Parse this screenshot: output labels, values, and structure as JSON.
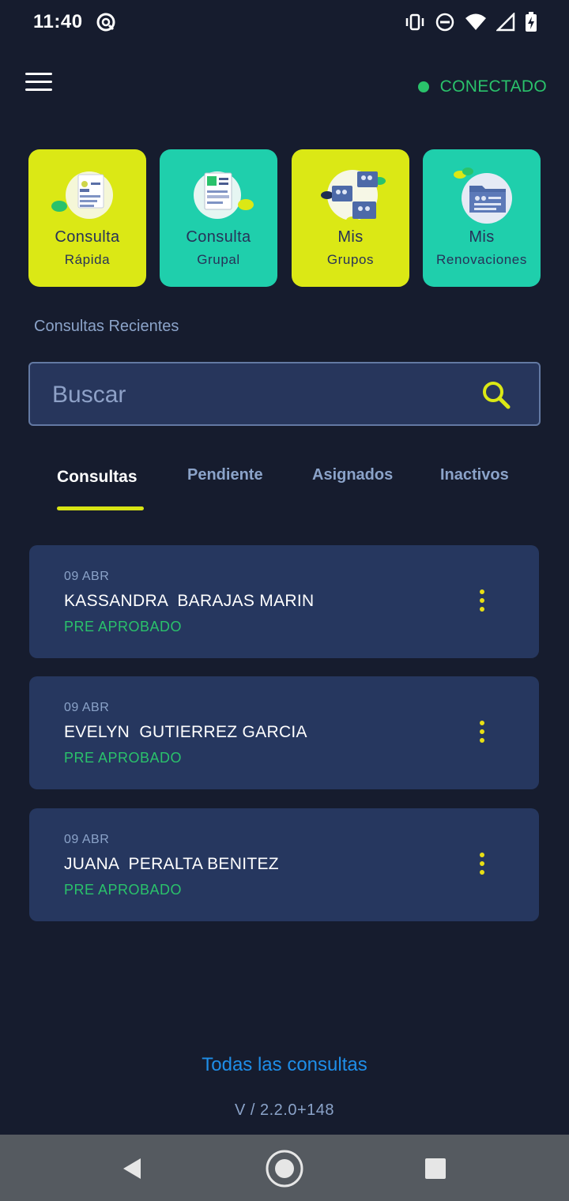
{
  "status_bar": {
    "time": "11:40",
    "icons": [
      "at-sign-icon",
      "vibrate-icon",
      "do-not-disturb-icon",
      "wifi-icon",
      "signal-icon",
      "battery-charging-icon"
    ]
  },
  "header": {
    "menu_icon": "hamburger-menu-icon",
    "connection_status": "CONECTADO",
    "connection_color": "#2ac26b"
  },
  "tiles": [
    {
      "line1": "Consulta",
      "line2": "Rápida",
      "icon": "id-card-icon",
      "color": "#dbe815"
    },
    {
      "line1": "Consulta",
      "line2": "Grupal",
      "icon": "group-document-icon",
      "color": "#1fcfac"
    },
    {
      "line1": "Mis",
      "line2": "Grupos",
      "icon": "groups-icon",
      "color": "#dbe815"
    },
    {
      "line1": "Mis",
      "line2": "Renovaciones",
      "icon": "folder-icon",
      "color": "#1fcfac"
    }
  ],
  "recent_section_title": "Consultas Recientes",
  "search": {
    "placeholder": "Buscar",
    "value": ""
  },
  "tabs": [
    {
      "label": "Consultas",
      "active": true
    },
    {
      "label": "Pendiente",
      "active": false
    },
    {
      "label": "Asignados",
      "active": false
    },
    {
      "label": "Inactivos",
      "active": false
    }
  ],
  "records": [
    {
      "date": "09 ABR",
      "name": "KASSANDRA  BARAJAS MARIN",
      "status": "PRE APROBADO"
    },
    {
      "date": "09 ABR",
      "name": "EVELYN  GUTIERREZ GARCIA",
      "status": "PRE APROBADO"
    },
    {
      "date": "09 ABR",
      "name": "JUANA  PERALTA BENITEZ",
      "status": "PRE APROBADO"
    }
  ],
  "all_consultations_link": "Todas las consultas",
  "version": "V / 2.2.0+148",
  "colors": {
    "background": "#161c2e",
    "card": "#26375f",
    "accent_yellow": "#d8e414",
    "link_blue": "#1f8ee8",
    "status_green": "#2ac26b"
  }
}
